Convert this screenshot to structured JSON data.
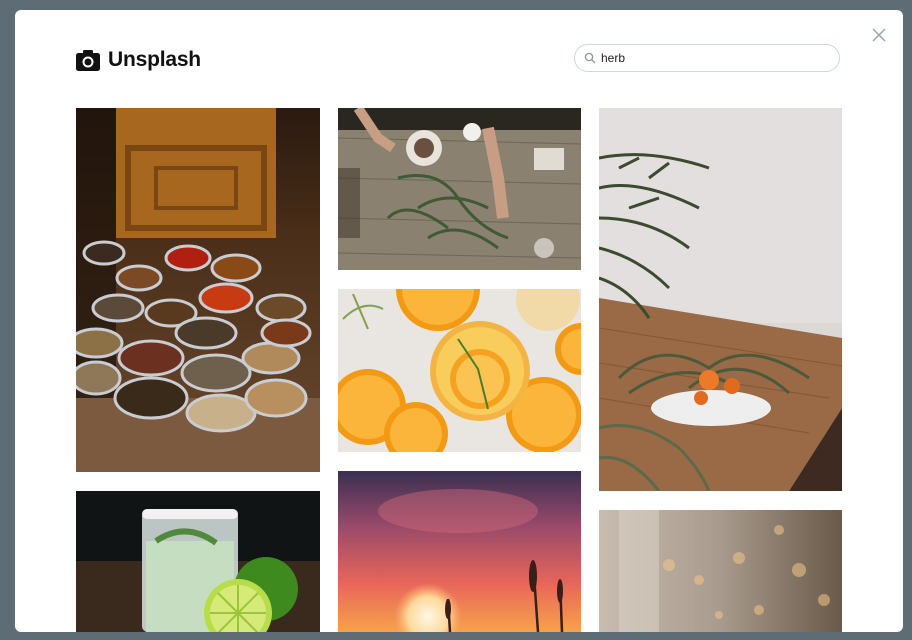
{
  "brand": {
    "name": "Unsplash",
    "icon": "camera-icon"
  },
  "search": {
    "value": "herb",
    "icon": "search-icon"
  },
  "close": {
    "icon": "close-icon"
  },
  "grid": {
    "columns": [
      {
        "photos": [
          {
            "subject": "spice-bowls"
          },
          {
            "subject": "cocktail-with-limes"
          }
        ]
      },
      {
        "photos": [
          {
            "subject": "hands-preparing-herbs"
          },
          {
            "subject": "orange-drink-slices"
          },
          {
            "subject": "sunset-grass"
          }
        ]
      },
      {
        "photos": [
          {
            "subject": "herbs-bowl-on-table"
          },
          {
            "subject": "blurred-lights"
          }
        ]
      }
    ]
  },
  "colors": {
    "backdrop": "#5d6c75",
    "modal": "#ffffff",
    "search_border": "#c9d8dc"
  }
}
